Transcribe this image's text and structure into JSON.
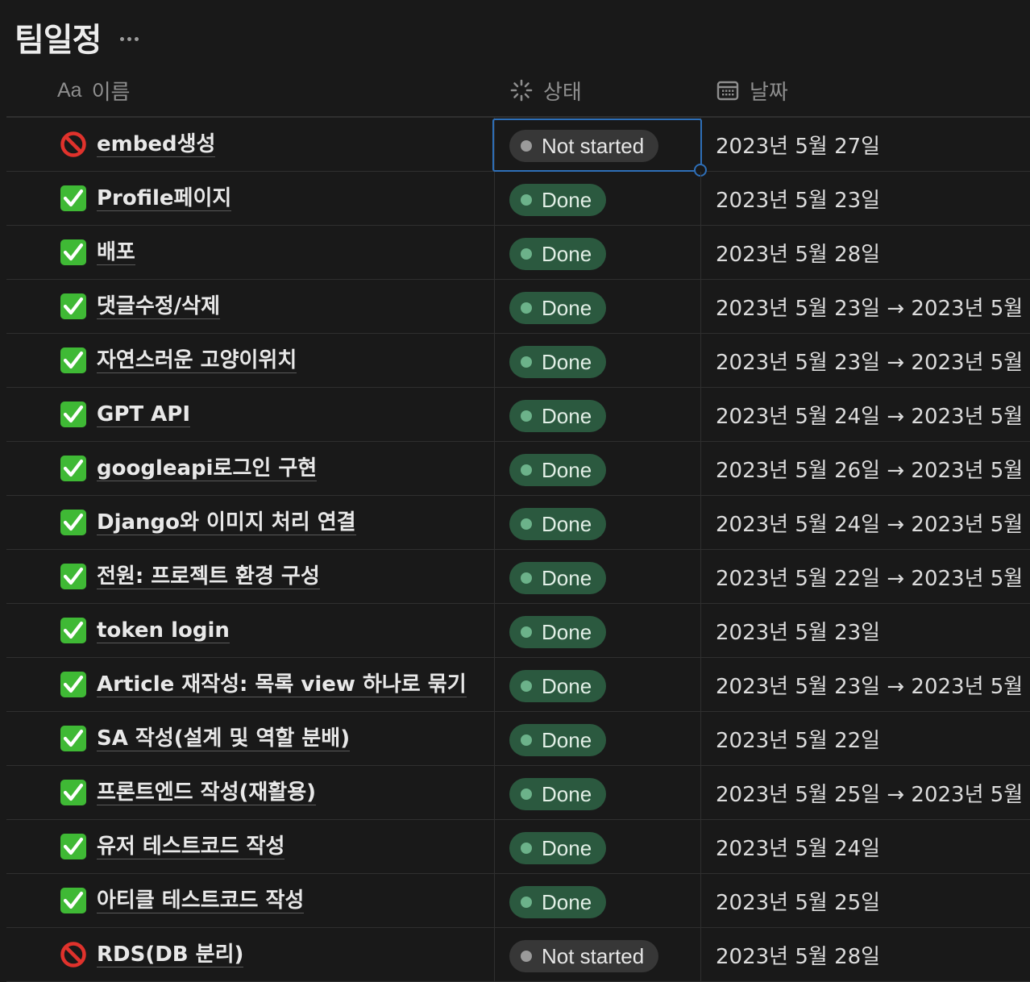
{
  "page": {
    "title": "팀일정"
  },
  "columns": {
    "name": {
      "icon_text": "Aa",
      "label": "이름",
      "icon": "text-property-icon"
    },
    "status": {
      "label": "상태",
      "icon": "status-property-icon"
    },
    "date": {
      "label": "날짜",
      "icon": "calendar-property-icon"
    }
  },
  "rows": [
    {
      "name": "embed생성",
      "icon": "prohibited-icon",
      "status": "Not started",
      "date": "2023년 5월 27일"
    },
    {
      "name": "Profile페이지",
      "icon": "check-mark-button-icon",
      "status": "Done",
      "date": "2023년 5월 23일"
    },
    {
      "name": "배포",
      "icon": "check-mark-button-icon",
      "status": "Done",
      "date": "2023년 5월 28일"
    },
    {
      "name": "댓글수정/삭제",
      "icon": "check-mark-button-icon",
      "status": "Done",
      "date": "2023년 5월 23일 → 2023년 5월"
    },
    {
      "name": "자연스러운 고양이위치",
      "icon": "check-mark-button-icon",
      "status": "Done",
      "date": "2023년 5월 23일 → 2023년 5월"
    },
    {
      "name": "GPT API",
      "icon": "check-mark-button-icon",
      "status": "Done",
      "date": "2023년 5월 24일 → 2023년 5월"
    },
    {
      "name": "googleapi로그인 구현",
      "icon": "check-mark-button-icon",
      "status": "Done",
      "date": "2023년 5월 26일 → 2023년 5월"
    },
    {
      "name": "Django와 이미지 처리 연결",
      "icon": "check-mark-button-icon",
      "status": "Done",
      "date": "2023년 5월 24일 → 2023년 5월"
    },
    {
      "name": "전원: 프로젝트 환경 구성",
      "icon": "check-mark-button-icon",
      "status": "Done",
      "date": "2023년 5월 22일 → 2023년 5월"
    },
    {
      "name": "token login",
      "icon": "check-mark-button-icon",
      "status": "Done",
      "date": "2023년 5월 23일"
    },
    {
      "name": "Article 재작성: 목록 view 하나로 묶기",
      "icon": "check-mark-button-icon",
      "status": "Done",
      "date": "2023년 5월 23일 → 2023년 5월"
    },
    {
      "name": "SA 작성(설계 및 역할 분배)",
      "icon": "check-mark-button-icon",
      "status": "Done",
      "date": "2023년 5월 22일"
    },
    {
      "name": "프론트엔드 작성(재활용)",
      "icon": "check-mark-button-icon",
      "status": "Done",
      "date": "2023년 5월 25일 → 2023년 5월"
    },
    {
      "name": "유저 테스트코드 작성",
      "icon": "check-mark-button-icon",
      "status": "Done",
      "date": "2023년 5월 24일"
    },
    {
      "name": "아티클 테스트코드 작성",
      "icon": "check-mark-button-icon",
      "status": "Done",
      "date": "2023년 5월 25일"
    },
    {
      "name": "RDS(DB 분리)",
      "icon": "prohibited-icon",
      "status": "Not started",
      "date": "2023년 5월 28일"
    }
  ],
  "status_colors": {
    "Done": "#2b593f",
    "Not started": "#373737"
  },
  "selected": {
    "row": 0,
    "column": "status"
  }
}
